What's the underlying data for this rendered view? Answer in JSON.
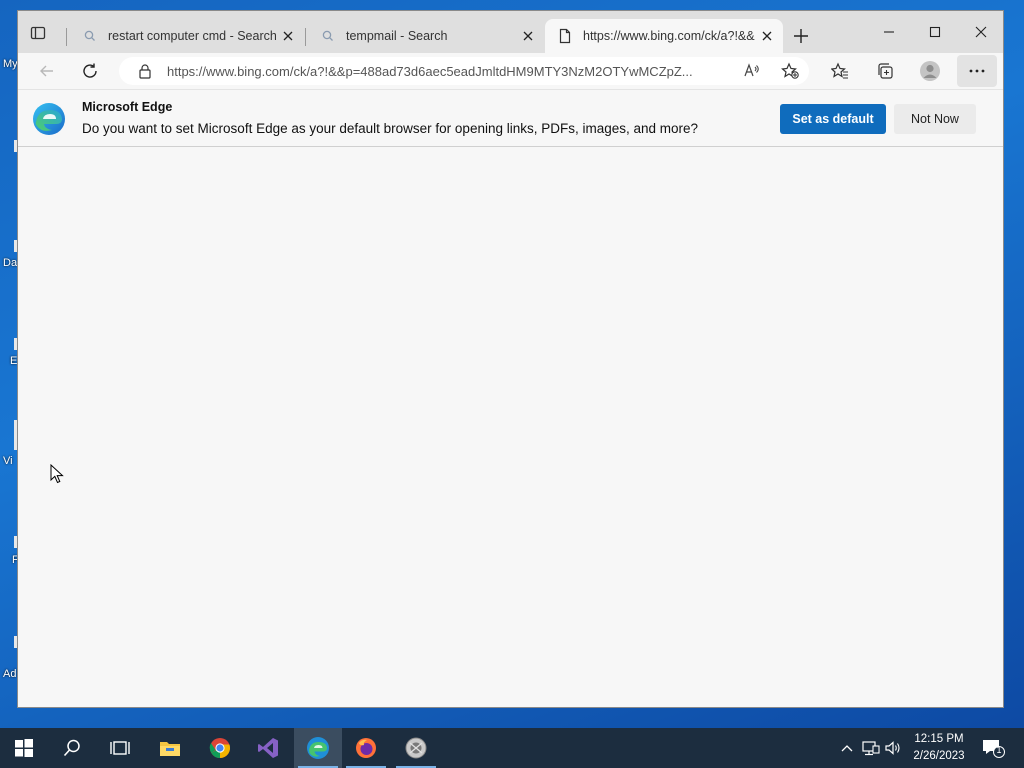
{
  "desktop": {
    "labels": [
      "My",
      "Da",
      "E",
      "Vi",
      "F",
      "Ad"
    ]
  },
  "browser": {
    "tabs": [
      {
        "title": "restart computer cmd - Search",
        "icon": "search-icon"
      },
      {
        "title": "tempmail - Search",
        "icon": "search-icon"
      },
      {
        "title": "https://www.bing.com/ck/a?!&&p=",
        "icon": "page-icon",
        "active": true
      }
    ],
    "address": {
      "url": "https://www.bing.com/ck/a?!&&p=488ad73d6aec5eadJmltdHM9MTY3NzM2OTYwMCZpZ..."
    },
    "infobar": {
      "title": "Microsoft Edge",
      "message": "Do you want to set Microsoft Edge as your default browser for opening links, PDFs, images, and more?",
      "primary_label": "Set as default",
      "secondary_label": "Not Now"
    }
  },
  "taskbar": {
    "apps": [
      "start-icon",
      "search-icon",
      "task-view-icon",
      "file-explorer-icon",
      "chrome-icon",
      "visual-studio-icon",
      "edge-icon",
      "firefox-icon",
      "app-icon"
    ],
    "clock_time": "12:15 PM",
    "clock_date": "2/26/2023",
    "notification_count": "1"
  },
  "colors": {
    "accent": "#0f6cbd",
    "taskbar": "#1c2d3f"
  }
}
